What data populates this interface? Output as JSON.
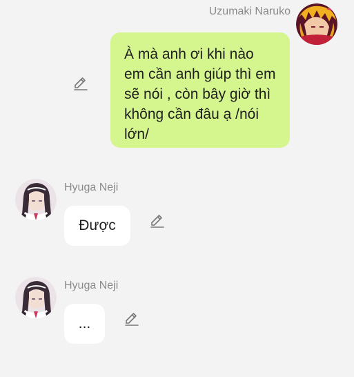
{
  "messages": [
    {
      "direction": "outgoing",
      "sender": "Uzumaki Naruko",
      "avatar_icon": "naruko-avatar-icon",
      "text": "À mà anh ơi khi nào em cần anh giúp thì em sẽ nói , còn bây giờ thì không cần đâu ạ /nói lớn/"
    },
    {
      "direction": "incoming",
      "sender": "Hyuga Neji",
      "avatar_icon": "neji-avatar-icon",
      "text": "Được"
    },
    {
      "direction": "incoming",
      "sender": "Hyuga Neji",
      "avatar_icon": "neji-avatar-icon",
      "text": "..."
    }
  ],
  "icons": {
    "edit": "pencil-edit-icon"
  },
  "colors": {
    "background": "#f3f3f3",
    "outgoing_bubble": "#d5f58f",
    "incoming_bubble": "#ffffff",
    "sender_name": "#8a8a8a",
    "message_text": "#1f1f1f"
  }
}
